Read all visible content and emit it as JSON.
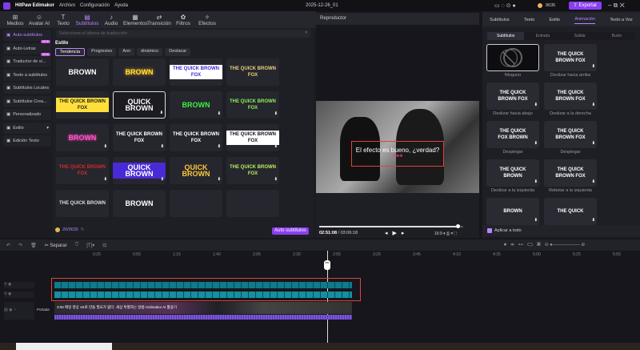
{
  "app": {
    "title": "HitPaw Edimakor",
    "menu": [
      "Archivo",
      "Configuración",
      "Ayuda"
    ],
    "project": "2025-12-26_01",
    "coins": "9635",
    "export": "Exportar"
  },
  "tabs": [
    {
      "label": "Medios",
      "icon": "⊞"
    },
    {
      "label": "Avatar AI",
      "icon": "☺"
    },
    {
      "label": "Texto",
      "icon": "T"
    },
    {
      "label": "Subtítulos",
      "icon": "▤"
    },
    {
      "label": "Audio",
      "icon": "♪"
    },
    {
      "label": "Elementos",
      "icon": "▦"
    },
    {
      "label": "Transición",
      "icon": "⇄"
    },
    {
      "label": "Filtros",
      "icon": "✿"
    },
    {
      "label": "Efectos",
      "icon": "✧"
    }
  ],
  "sidebar": [
    {
      "label": "Auto-subtítulos"
    },
    {
      "label": "Auto-Letras",
      "badge": "NEW"
    },
    {
      "label": "Traductor de vi...",
      "badge": "NEW"
    },
    {
      "label": "Texto a subtítulos"
    },
    {
      "label": "Subtítulos Locales"
    },
    {
      "label": "Subtítulos Crea..."
    },
    {
      "label": "Personalizado"
    },
    {
      "label": "Estilo"
    },
    {
      "label": "Edición Texto"
    }
  ],
  "subtitles": {
    "lang_placeholder": "Seleccione el idioma de traducción",
    "style_title": "Estilo",
    "chips": [
      "Tendencia",
      "Progresivo",
      "Aon",
      "dinámico",
      "Destacar"
    ],
    "cards": [
      {
        "t": "BROWN",
        "c": "#ffffff"
      },
      {
        "t": "BROWN",
        "c": "#ffe03a"
      },
      {
        "t": "THE QUICK BROWN FOX",
        "c": "#3b2ad6"
      },
      {
        "t": "THE QUICK BROWN FOX",
        "c": "#e8d27a"
      },
      {
        "t": "THE QUICK BROWN FOX",
        "c": "#222222"
      },
      {
        "t": "QUICK BROWN",
        "c": "#ffffff"
      },
      {
        "t": "BROWN",
        "c": "#3df23d"
      },
      {
        "t": "THE QUICK BROWN FOX",
        "c": "#8ef05a"
      },
      {
        "t": "BROWN",
        "c": "#ff4fc0"
      },
      {
        "t": "THE QUICK BROWN FOX",
        "c": "#ffffff"
      },
      {
        "t": "THE QUICK BROWN FOX",
        "c": "#ffffff"
      },
      {
        "t": "THE QUICK BROWN FOX",
        "c": "#111111"
      },
      {
        "t": "THE QUICK BROWN FOX",
        "c": "#d22a2a"
      },
      {
        "t": "QUICK BROWN",
        "c": "#ffffff"
      },
      {
        "t": "QUICK BROWN",
        "c": "#ffc83a"
      },
      {
        "t": "THE QUICK BROWN FOX",
        "c": "#b7f05a"
      },
      {
        "t": "THE QUICK BROWN",
        "c": "#dddddd"
      },
      {
        "t": "BROWN",
        "c": "#ffffff"
      },
      {
        "t": "",
        "c": "#fff"
      },
      {
        "t": "",
        "c": "#fff"
      }
    ],
    "credits": "20/9635",
    "auto_button": "Auto subtítulos"
  },
  "player": {
    "title": "Reproductor",
    "subtitle": "El efecto es bueno, ¿verdad?",
    "time": "02:51:08",
    "duration": "03:06:18",
    "ratio": "16:9",
    "progress": 0.95
  },
  "right": {
    "tabs": [
      "Subtítulos",
      "Texto",
      "Estilo",
      "Animación",
      "Texto a Voz"
    ],
    "subtabs": [
      "Subtítulos",
      "Entrada",
      "Salida",
      "Bucle"
    ],
    "anims": [
      {
        "t": "",
        "l": "Ninguno"
      },
      {
        "t": "THE QUICK BROWN FOX",
        "l": "Deslizar hacia arriba"
      },
      {
        "t": "THE QUICK BROWN FOX",
        "l": "Deslizar hacia abajo"
      },
      {
        "t": "THE QUICK BROWN FOX",
        "l": "Deslizar a la derecha"
      },
      {
        "t": "THE QUICK FOX BROWN",
        "l": "Desplegar"
      },
      {
        "t": "THE QUICK BROWN FOX",
        "l": "Desplegar"
      },
      {
        "t": "THE QUICK BROWN",
        "l": "Deslizar a la izquierda"
      },
      {
        "t": "THE QUICK BROWN FOX",
        "l": "Rebotar a la izquierda"
      },
      {
        "t": "BROWN",
        "l": ""
      },
      {
        "t": "THE QUICK",
        "l": ""
      }
    ],
    "apply_all": "Aplicar a todo"
  },
  "timeline": {
    "split": "Separar",
    "ticks": [
      "0:25",
      "0:50",
      "1:15",
      "1:40",
      "2:05",
      "2:30",
      "2:55",
      "3:20",
      "3:45",
      "4:10",
      "4:35",
      "5:00",
      "5:25",
      "5:50"
    ],
    "track_label": "Portada",
    "clip_title": "3:06 매일 영상 4K로 만들 필요가 없다. 세상 특별하는 방법! Edimakor AI 활용기"
  },
  "colors": {
    "accent": "#8a3ff0",
    "highlight": "#e0443a",
    "track": "#0f7a8a"
  }
}
